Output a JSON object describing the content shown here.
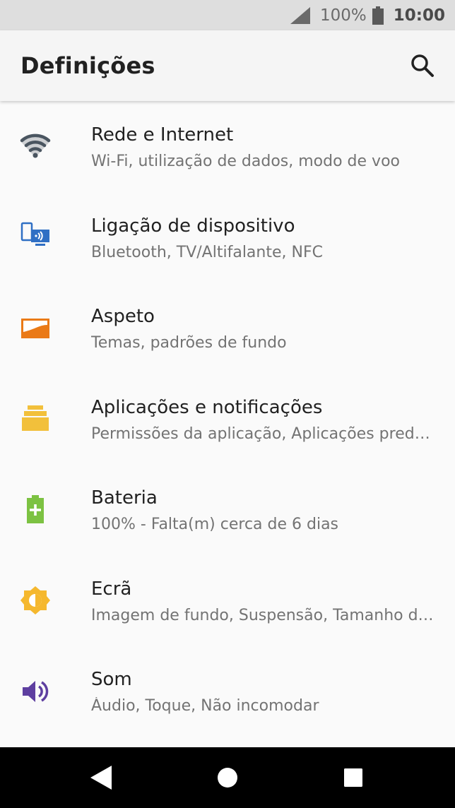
{
  "status_bar": {
    "battery_percent": "100%",
    "time": "10:00",
    "icons": [
      "signal-icon",
      "battery-icon"
    ]
  },
  "app_bar": {
    "title": "Definições",
    "search_icon": "search-icon"
  },
  "settings": [
    {
      "label": "Rede e Internet",
      "summary": "Wi-Fi, utilização de dados, modo de voo",
      "icon": "wifi-icon",
      "color": "#4a5560"
    },
    {
      "label": "Ligação de dispositivo",
      "summary": "Bluetooth, TV/Altifalante, NFC",
      "icon": "connected-devices-icon",
      "color": "#2f6fc4"
    },
    {
      "label": "Aspeto",
      "summary": "Temas, padrões de fundo",
      "icon": "wallpaper-icon",
      "color": "#ea7a17"
    },
    {
      "label": "Aplicações e notificações",
      "summary": "Permissões da aplicação, Aplicações pred…",
      "icon": "apps-icon",
      "color": "#f2c03b"
    },
    {
      "label": "Bateria",
      "summary": "100% - Falta(m) cerca de 6 dias",
      "icon": "battery-charging-icon",
      "color": "#7cc242"
    },
    {
      "label": "Ecrã",
      "summary": "Imagem de fundo, Suspensão, Tamanho d…",
      "icon": "brightness-icon",
      "color": "#f5b82e"
    },
    {
      "label": "Som",
      "summary": "Áudio, Toque, Não incomodar",
      "icon": "volume-icon",
      "color": "#5e3fa0"
    }
  ],
  "nav_bar": {
    "buttons": [
      "back-icon",
      "home-icon",
      "recents-icon"
    ]
  }
}
